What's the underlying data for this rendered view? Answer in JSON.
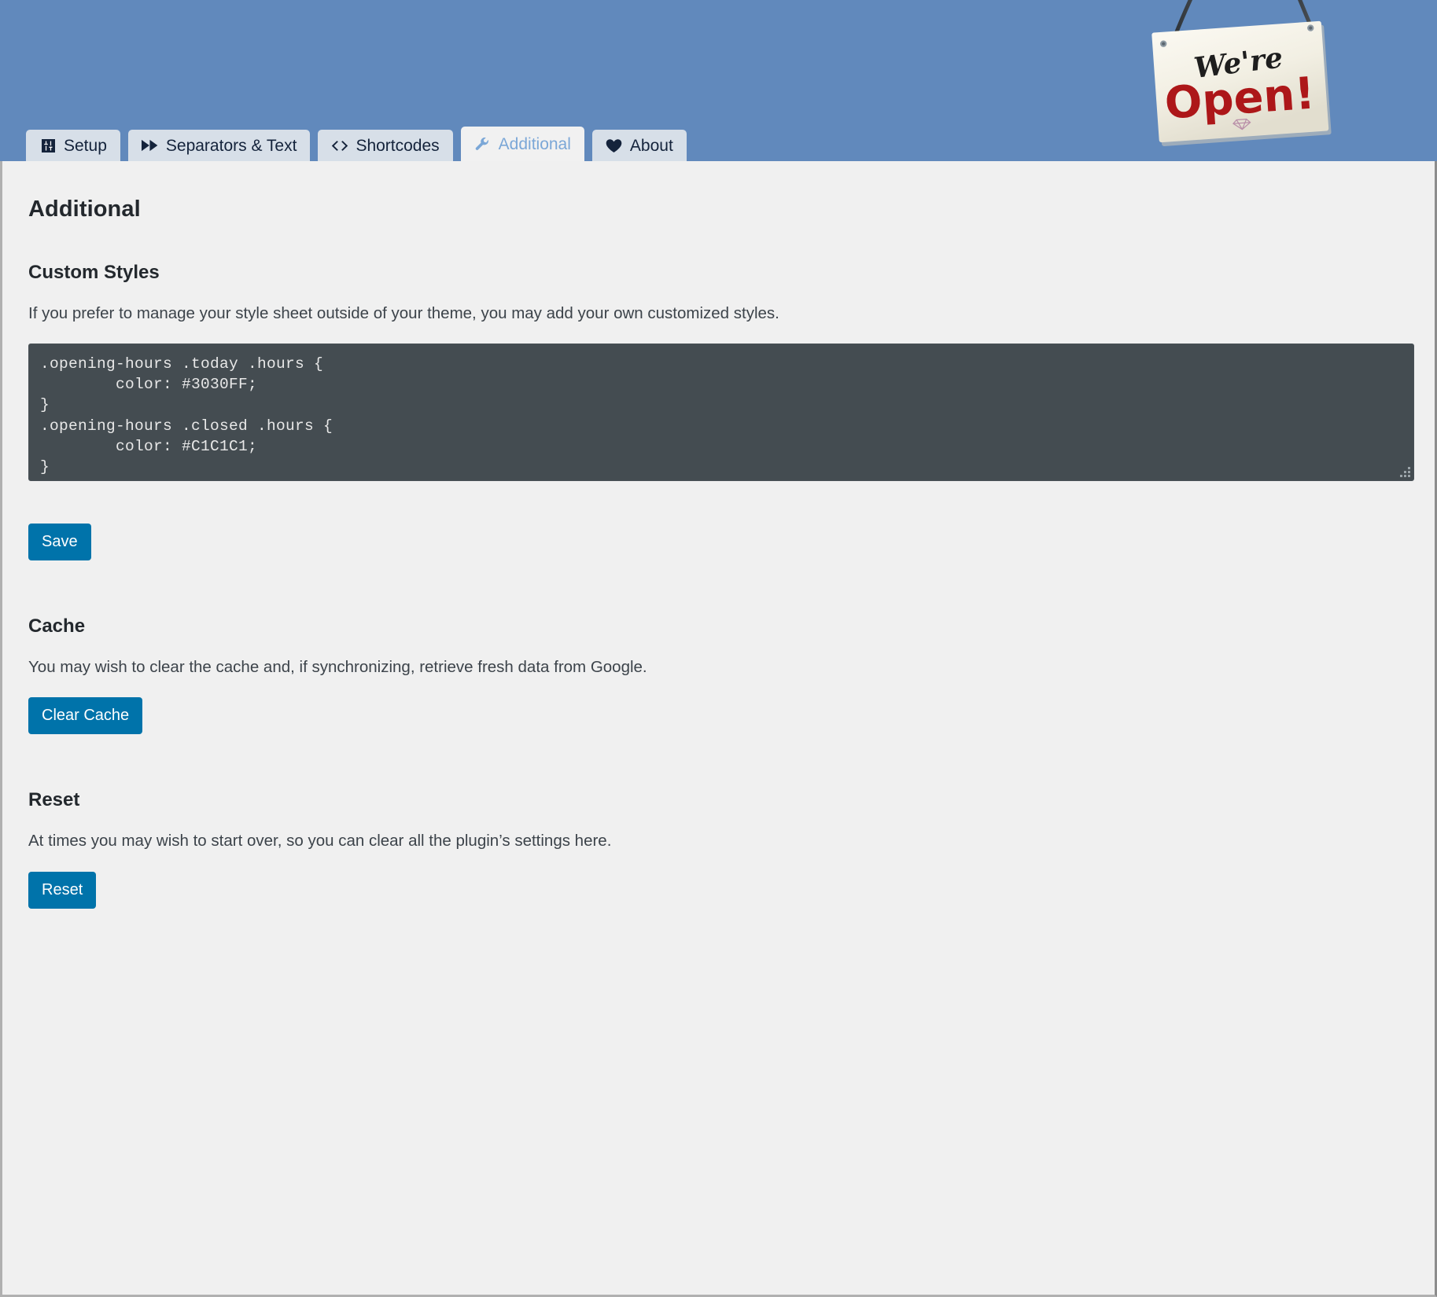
{
  "banner": {
    "background_color": "#6189BC",
    "sign": {
      "line1": "We're",
      "line2": "Open!",
      "alt": "we-are-open-hanging-sign"
    }
  },
  "tabs": [
    {
      "id": "setup",
      "label": "Setup",
      "icon": "sliders-icon",
      "active": false
    },
    {
      "id": "separators-text",
      "label": "Separators & Text",
      "icon": "fast-forward-icon",
      "active": false
    },
    {
      "id": "shortcodes",
      "label": "Shortcodes",
      "icon": "code-icon",
      "active": false
    },
    {
      "id": "additional",
      "label": "Additional",
      "icon": "wrench-icon",
      "active": true
    },
    {
      "id": "about",
      "label": "About",
      "icon": "heart-icon",
      "active": false
    }
  ],
  "page": {
    "title": "Additional"
  },
  "custom_styles": {
    "heading": "Custom Styles",
    "description": "If you prefer to manage your style sheet outside of your theme, you may add your own customized styles.",
    "code_value": ".opening-hours .today .hours {\n        color: #3030FF;\n}\n.opening-hours .closed .hours {\n        color: #C1C1C1;\n}",
    "code_placeholder": "",
    "save_label": "Save"
  },
  "cache": {
    "heading": "Cache",
    "description": "You may wish to clear the cache and, if synchronizing, retrieve fresh data from Google.",
    "button_label": "Clear Cache"
  },
  "reset": {
    "heading": "Reset",
    "description": "At times you may wish to start over, so you can clear all the plugin’s settings here.",
    "button_label": "Reset"
  },
  "colors": {
    "banner": "#6189BC",
    "tab_inactive_bg": "#D7DFE8",
    "tab_active_bg": "#F1F1F1",
    "tab_active_text": "#7BA7D7",
    "content_bg": "#F0F0F0",
    "button_bg": "#0073AA",
    "code_bg": "#444C51",
    "code_text": "#E8E8E8",
    "heading_text": "#23282d"
  }
}
